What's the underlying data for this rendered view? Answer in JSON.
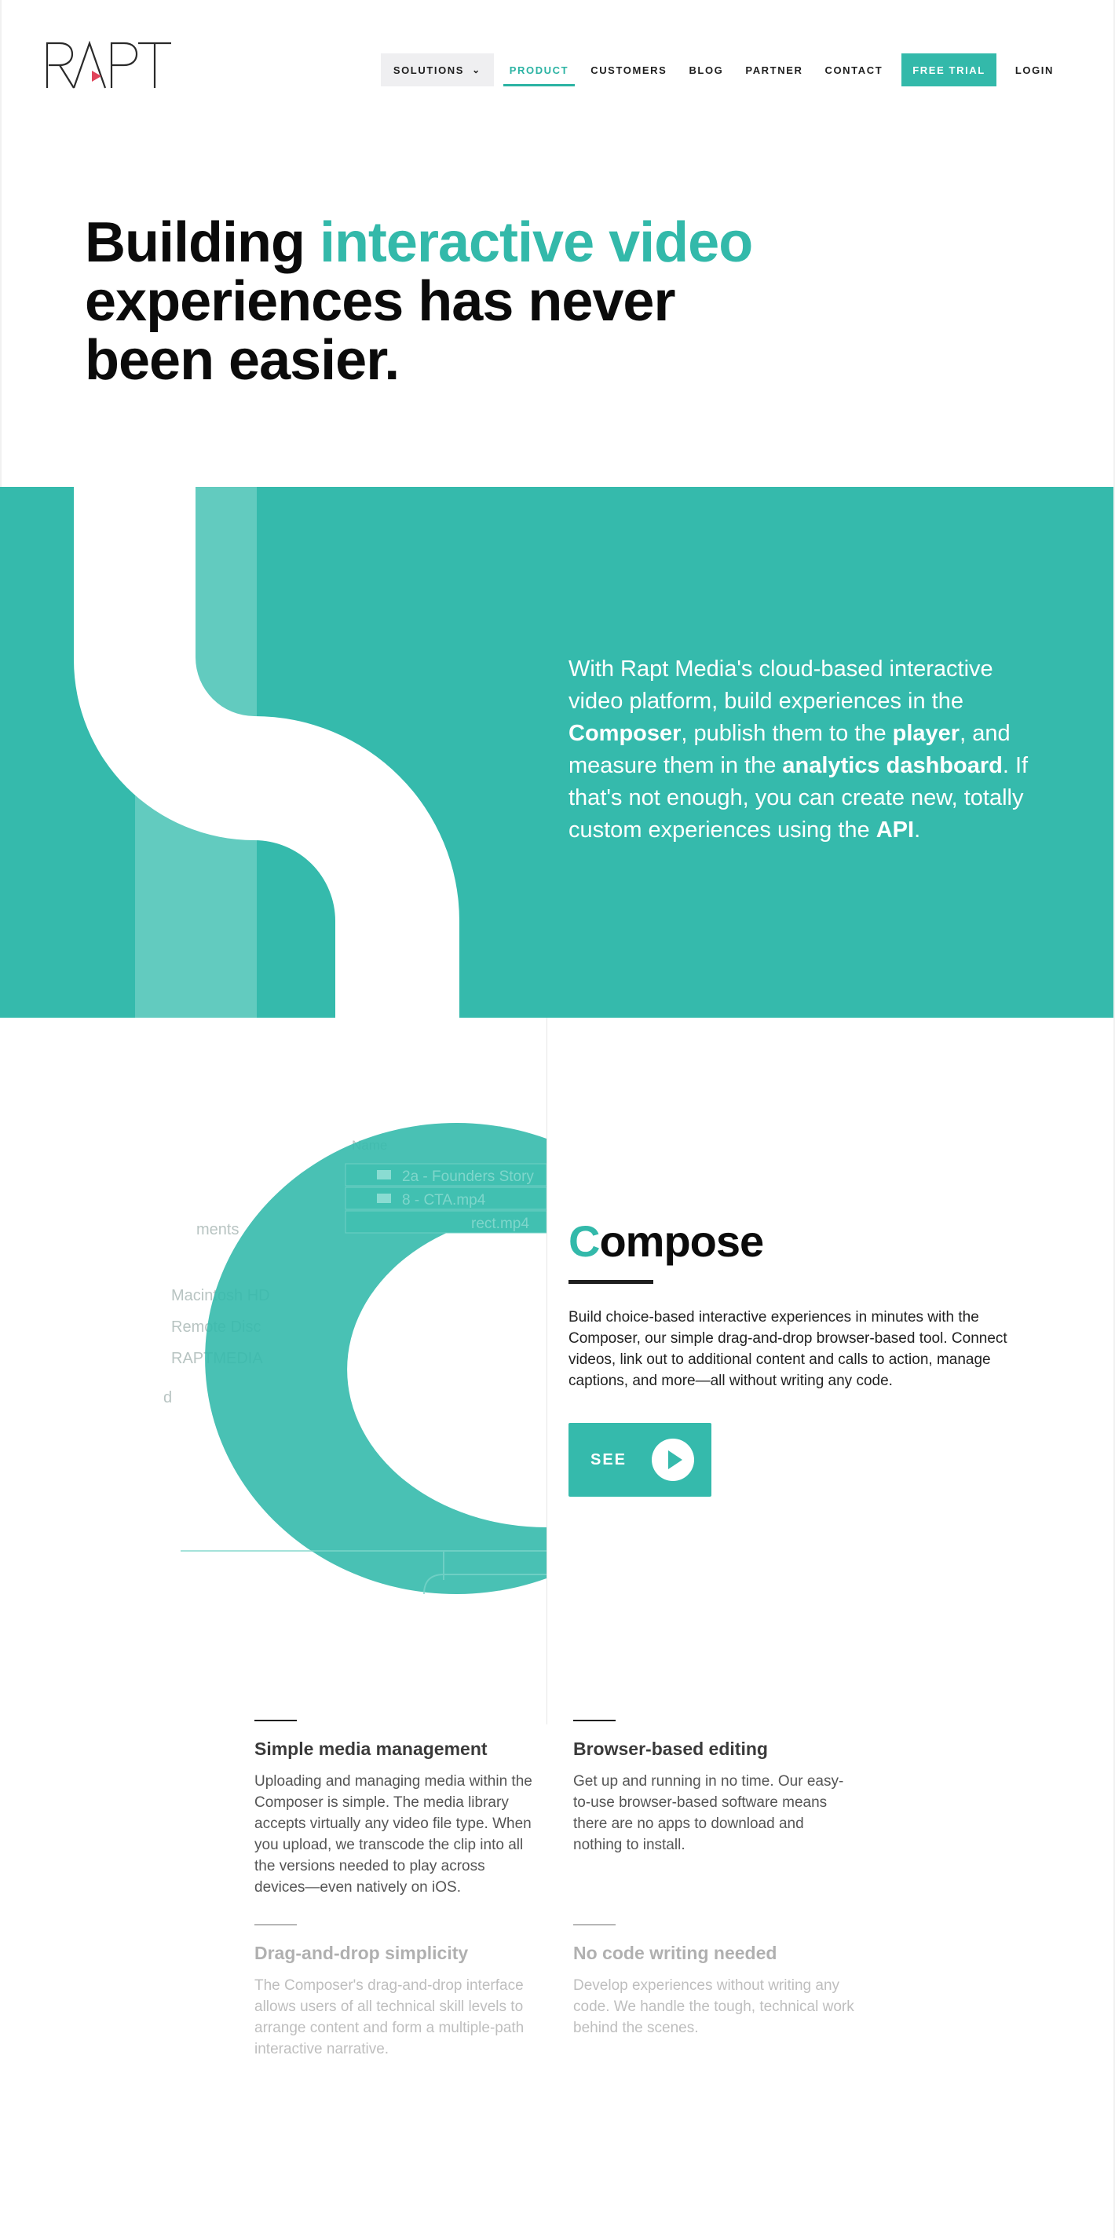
{
  "header": {
    "logo_text": "RAPT",
    "nav": {
      "solutions": "SOLUTIONS",
      "product": "PRODUCT",
      "customers": "CUSTOMERS",
      "blog": "BLOG",
      "partner": "PARTNER",
      "contact": "CONTACT",
      "free_trial": "FREE TRIAL",
      "login": "LOGIN"
    }
  },
  "hero": {
    "title_part1": "Building ",
    "title_accent": "interactive video",
    "title_part2": "experiences has never been easier."
  },
  "intro": {
    "t1": "With Rapt Media's cloud-based interactive video platform, build experiences in the ",
    "b1": "Composer",
    "t2": ", publish them to the ",
    "b2": "player",
    "t3": ", and measure them in the ",
    "b3": "analytics dashboard",
    "t4": ". If that's not enough, you can create new, totally custom experiences using the ",
    "b4": "API",
    "t5": "."
  },
  "compose": {
    "title_first": "C",
    "title_rest": "ompose",
    "description": "Build choice-based interactive experiences in minutes with the Composer, our simple drag-and-drop browser-based tool. Connect videos, link out to additional content and calls to action, manage captions, and more—all without writing any code.",
    "button_label": "SEE",
    "art": {
      "name_header": "Name",
      "file1": "2a - Founders Story",
      "file2": "8 - CTA.mp4",
      "file3": "rect.mp4",
      "side1": "ments",
      "side2": "Macintosh HD",
      "side3": "Remote Disc",
      "side4": "RAPTMEDIA",
      "side5": "d"
    }
  },
  "features": [
    {
      "title": "Simple media management",
      "text": "Uploading and managing media within the Composer is simple. The media library accepts virtually any video file type. When you upload, we transcode the clip into all the versions needed to play across devices—even natively on iOS."
    },
    {
      "title": "Browser-based editing",
      "text": "Get up and running in no time. Our easy-to-use browser-based software means there are no apps to download and nothing to install."
    },
    {
      "title": "Drag-and-drop simplicity",
      "text": "The Composer's drag-and-drop interface allows users of all technical skill levels to arrange content and form a multiple-path interactive narrative."
    },
    {
      "title": "No code writing needed",
      "text": "Develop experiences without writing any code. We handle the tough, technical work behind the scenes."
    }
  ],
  "colors": {
    "teal": "#35baac",
    "teal_light": "#62cbbf",
    "accent_text": "#33b9aa"
  }
}
